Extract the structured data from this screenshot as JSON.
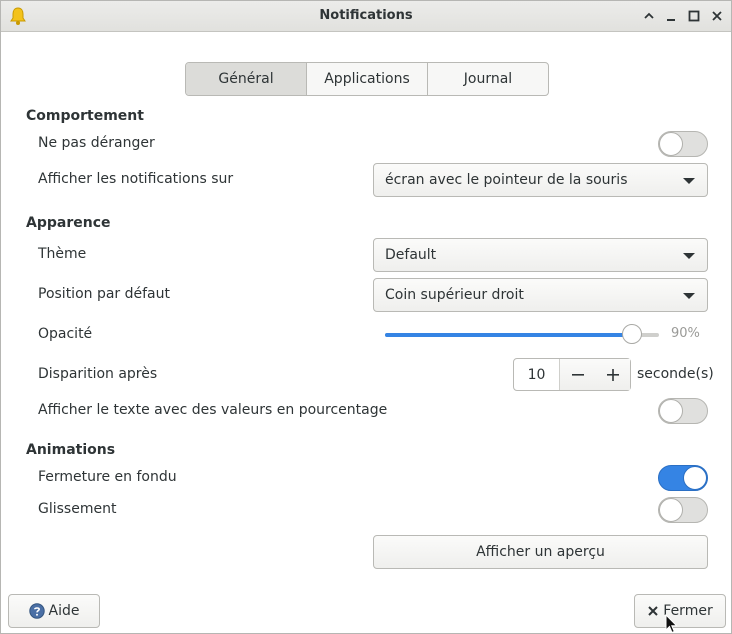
{
  "window": {
    "title": "Notifications",
    "icon": "bell-icon",
    "controls": [
      "minimize-icon",
      "restore-icon",
      "maximize-icon",
      "close-icon"
    ]
  },
  "tabs": [
    {
      "label": "Général",
      "active": true
    },
    {
      "label": "Applications",
      "active": false
    },
    {
      "label": "Journal",
      "active": false
    }
  ],
  "behavior": {
    "heading": "Comportement",
    "dnd_label": "Ne pas déranger",
    "dnd_on": false,
    "show_on_label": "Afficher les notifications sur",
    "show_on_value": "écran avec le pointeur de la souris"
  },
  "appearance": {
    "heading": "Apparence",
    "theme_label": "Thème",
    "theme_value": "Default",
    "position_label": "Position par défaut",
    "position_value": "Coin supérieur droit",
    "opacity_label": "Opacité",
    "opacity_value": 90,
    "opacity_text": "90%",
    "disappear_label": "Disparition après",
    "disappear_value": "10",
    "disappear_unit": "seconde(s)",
    "percent_label": "Afficher le texte avec des valeurs en pourcentage",
    "percent_on": false
  },
  "animations": {
    "heading": "Animations",
    "fade_label": "Fermeture en fondu",
    "fade_on": true,
    "slide_label": "Glissement",
    "slide_on": false
  },
  "preview_button": "Afficher un aperçu",
  "footer": {
    "help_label": "Aide",
    "close_label": "Fermer"
  },
  "colors": {
    "accent": "#3584e4"
  }
}
